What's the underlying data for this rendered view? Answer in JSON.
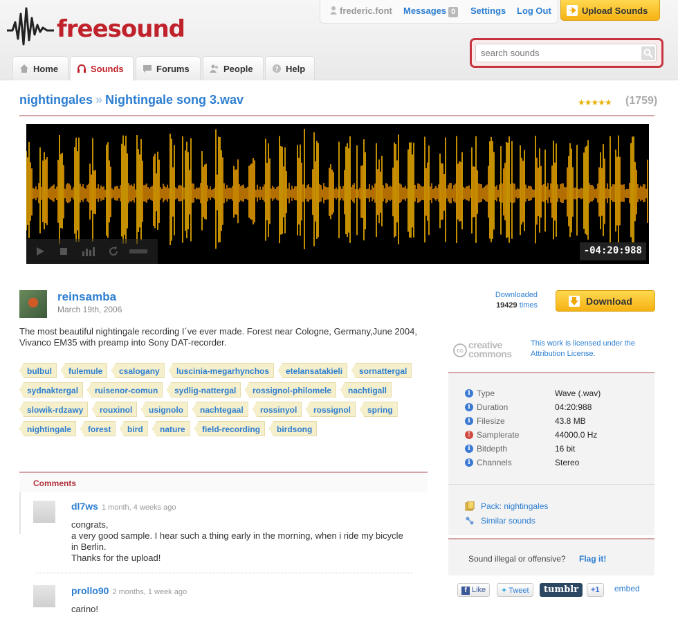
{
  "header": {
    "logo_text": "freesound",
    "username": "frederic.font",
    "messages_label": "Messages",
    "messages_count": "0",
    "settings_label": "Settings",
    "logout_label": "Log Out",
    "upload_label": "Upload Sounds",
    "search_placeholder": "search sounds"
  },
  "nav": {
    "tabs": [
      {
        "label": "Home",
        "icon": "home-icon"
      },
      {
        "label": "Sounds",
        "icon": "headphones-icon",
        "active": true
      },
      {
        "label": "Forums",
        "icon": "speech-bubble-icon"
      },
      {
        "label": "People",
        "icon": "people-icon"
      },
      {
        "label": "Help",
        "icon": "help-icon"
      }
    ]
  },
  "sound": {
    "pack": "nightingales",
    "separator": "»",
    "name": "Nightingale song 3.wav",
    "rating_count": "(1759)",
    "rating_stars": 4.5,
    "timecode": "-04:20:988",
    "uploader": "reinsamba",
    "date": "March 19th, 2006",
    "downloaded_label": "Downloaded",
    "downloaded_count": "19429",
    "downloaded_suffix": "times",
    "download_label": "Download",
    "description": "The most beautiful nightingale recording I´ve ever made. Forest near Cologne, Germany,June 2004, Vivanco EM35 with preamp into Sony DAT-recorder."
  },
  "tags": [
    "bulbul",
    "fulemule",
    "csalogany",
    "luscinia-megarhynchos",
    "etelansatakieli",
    "sornattergal",
    "sydnaktergal",
    "ruisenor-comun",
    "sydlig-nattergal",
    "rossignol-philomele",
    "nachtigall",
    "slowik-rdzawy",
    "rouxinol",
    "usignolo",
    "nachtegaal",
    "rossinyol",
    "rossignol",
    "spring",
    "nightingale",
    "forest",
    "bird",
    "nature",
    "field-recording",
    "birdsong"
  ],
  "license": {
    "logo_line1": "creative",
    "logo_line2": "commons",
    "cc_mark": "cc",
    "text": "This work is licensed under the Attribution License."
  },
  "info": {
    "rows": [
      {
        "label": "Type",
        "value": "Wave (.wav)",
        "icon": "info-icon"
      },
      {
        "label": "Duration",
        "value": "04:20:988",
        "icon": "info-icon"
      },
      {
        "label": "Filesize",
        "value": "43.8 MB",
        "icon": "info-icon"
      },
      {
        "label": "Samplerate",
        "value": "44000.0 Hz",
        "icon": "warning-icon"
      },
      {
        "label": "Bitdepth",
        "value": "16 bit",
        "icon": "info-icon"
      },
      {
        "label": "Channels",
        "value": "Stereo",
        "icon": "info-icon"
      }
    ],
    "pack_link": "Pack: nightingales",
    "similar_link": "Similar sounds"
  },
  "flag": {
    "question": "Sound illegal or offensive?",
    "link": "Flag it!"
  },
  "share": {
    "facebook": "Like",
    "twitter": "Tweet",
    "tumblr": "tumblr",
    "gplus": "+1",
    "embed": "embed"
  },
  "comments": {
    "title": "Comments",
    "items": [
      {
        "user": "dl7ws",
        "time": "1 month, 4 weeks ago",
        "text": "congrats,\na very good sample. I hear such a thing early in the morning, when i ride my bicycle in Berlin.\nThanks for the upload!"
      },
      {
        "user": "prollo90",
        "time": "2 months, 1 week ago",
        "text": "carino!"
      }
    ]
  },
  "colors": {
    "brand_red": "#c0222b",
    "link_blue": "#2c7ed1",
    "waveform_yellow": "#f5b400",
    "button_yellow": "#f5b213"
  }
}
